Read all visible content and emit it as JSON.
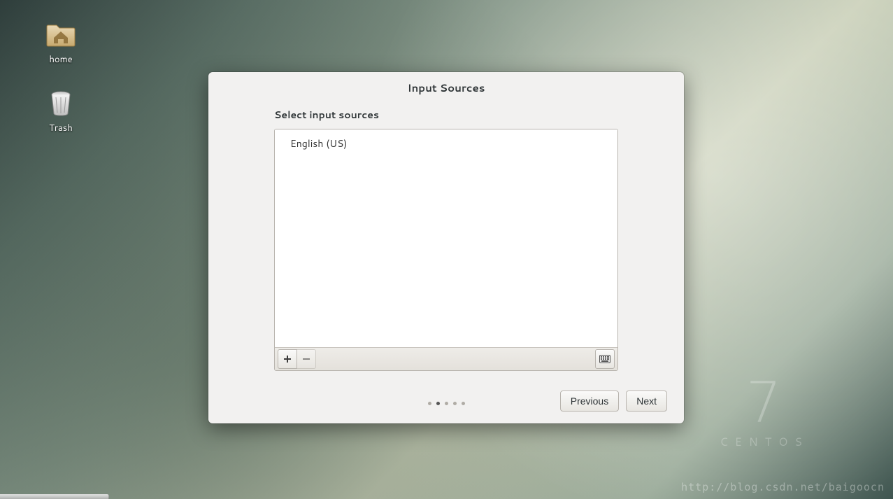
{
  "desktop": {
    "icons": {
      "home_label": "home",
      "trash_label": "Trash"
    },
    "brand": {
      "version": "7",
      "name": "CENTOS"
    },
    "watermark_url": "http://blog.csdn.net/baigoocn"
  },
  "dialog": {
    "title": "Input Sources",
    "section_label": "Select input sources",
    "sources": [
      {
        "label": "English (US)"
      }
    ],
    "buttons": {
      "previous": "Previous",
      "next": "Next"
    },
    "pager": {
      "total": 5,
      "active_index": 1
    }
  }
}
